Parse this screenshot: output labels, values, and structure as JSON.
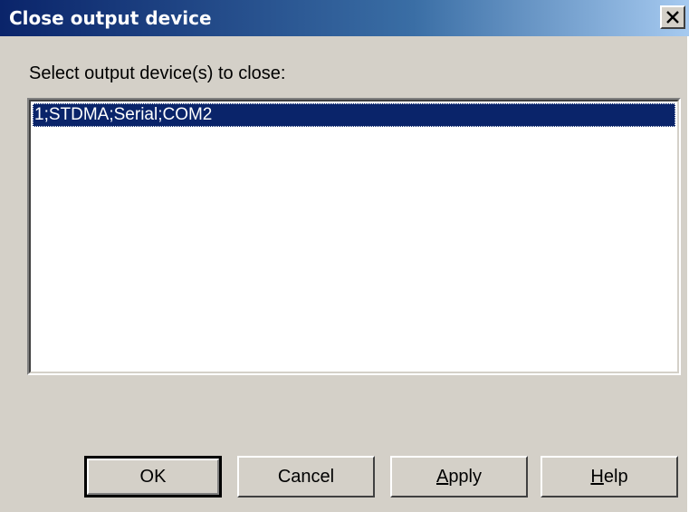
{
  "window": {
    "title": "Close output device",
    "close_icon": "close-x-icon"
  },
  "prompt": "Select output device(s) to close:",
  "devices": {
    "items": [
      {
        "label": "1;STDMA;Serial;COM2",
        "selected": true
      }
    ]
  },
  "buttons": {
    "ok": {
      "label": "OK"
    },
    "cancel": {
      "label": "Cancel"
    },
    "apply": {
      "mnemonic": "A",
      "rest": "pply"
    },
    "help": {
      "mnemonic": "H",
      "rest": "elp"
    }
  },
  "colors": {
    "title_start": "#0a246a",
    "title_end": "#a6caf0",
    "selection": "#0a246a",
    "face": "#d4d0c8"
  }
}
